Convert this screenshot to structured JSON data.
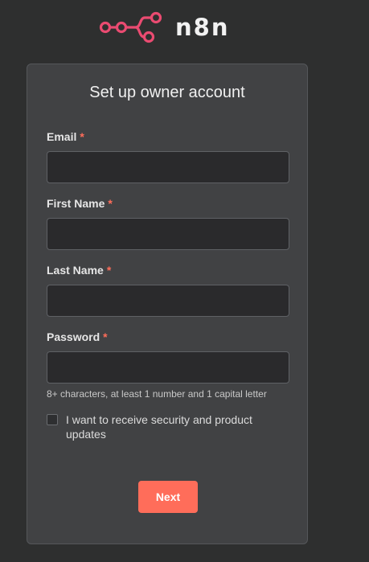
{
  "brand": {
    "name": "n8n",
    "accent_color": "#ea4b71",
    "logo_icon": "n8n-nodes-logo-icon"
  },
  "form": {
    "title": "Set up owner account",
    "required_marker": "*",
    "fields": [
      {
        "label": "Email",
        "value": ""
      },
      {
        "label": "First Name",
        "value": ""
      },
      {
        "label": "Last Name",
        "value": ""
      },
      {
        "label": "Password",
        "value": ""
      }
    ],
    "password_hint": "8+ characters, at least 1 number and 1 capital letter",
    "opt_in_label": "I want to receive security and product updates",
    "opt_in_checked": false,
    "submit_label": "Next",
    "submit_color": "#ff6d5a"
  }
}
